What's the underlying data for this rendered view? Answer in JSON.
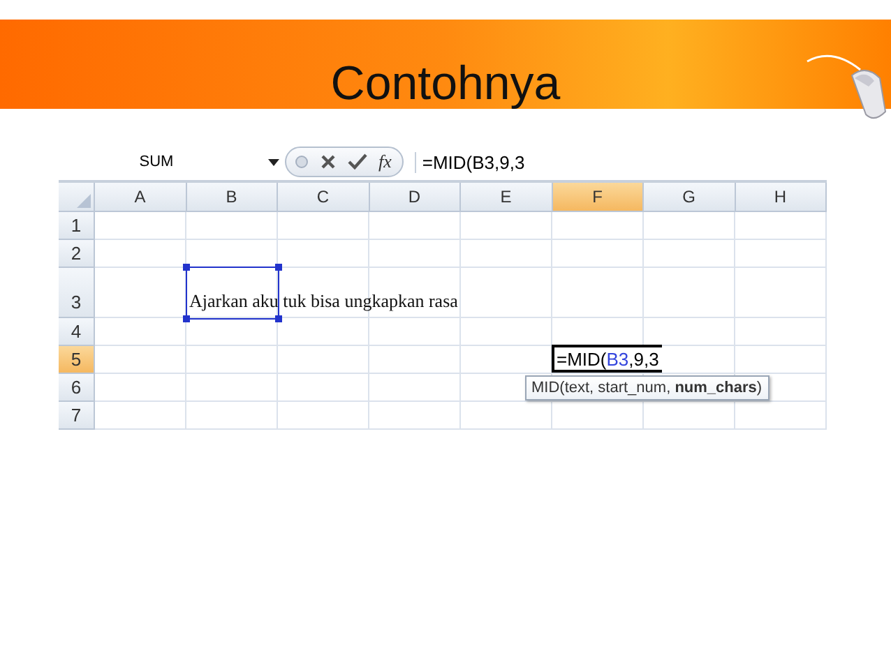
{
  "slide": {
    "title": "Contohnya"
  },
  "formula_bar": {
    "name_box": "SUM",
    "function_label": "fx",
    "formula": "=MID(B3,9,3"
  },
  "columns": [
    {
      "label": "A",
      "selected": false
    },
    {
      "label": "B",
      "selected": false
    },
    {
      "label": "C",
      "selected": false
    },
    {
      "label": "D",
      "selected": false
    },
    {
      "label": "E",
      "selected": false
    },
    {
      "label": "F",
      "selected": true
    },
    {
      "label": "G",
      "selected": false
    },
    {
      "label": "H",
      "selected": false
    }
  ],
  "rows": [
    {
      "label": "1",
      "selected": false,
      "tall": false,
      "cells": [
        null,
        null,
        null,
        null,
        null,
        null,
        null,
        null
      ]
    },
    {
      "label": "2",
      "selected": false,
      "tall": false,
      "cells": [
        null,
        null,
        null,
        null,
        null,
        null,
        null,
        null
      ]
    },
    {
      "label": "3",
      "selected": false,
      "tall": true,
      "cells": [
        null,
        {
          "text": "Ajarkan aku tuk bisa ungkapkan rasa",
          "selected": true
        },
        null,
        null,
        null,
        null,
        null,
        null
      ]
    },
    {
      "label": "4",
      "selected": false,
      "tall": false,
      "cells": [
        null,
        null,
        null,
        null,
        null,
        null,
        null,
        null
      ]
    },
    {
      "label": "5",
      "selected": true,
      "tall": false,
      "cells": [
        null,
        null,
        null,
        null,
        null,
        {
          "editing": true,
          "parts": [
            {
              "text": "=MID("
            },
            {
              "text": "B3",
              "kind": "reference"
            },
            {
              "text": ",9,3"
            }
          ],
          "tooltip": "MID(text, start_num, **num_chars**)"
        },
        null,
        null
      ]
    },
    {
      "label": "6",
      "selected": false,
      "tall": false,
      "cells": [
        null,
        null,
        null,
        null,
        null,
        null,
        null,
        null
      ]
    },
    {
      "label": "7",
      "selected": false,
      "tall": false,
      "cells": [
        null,
        null,
        null,
        null,
        null,
        null,
        null,
        null
      ]
    }
  ]
}
